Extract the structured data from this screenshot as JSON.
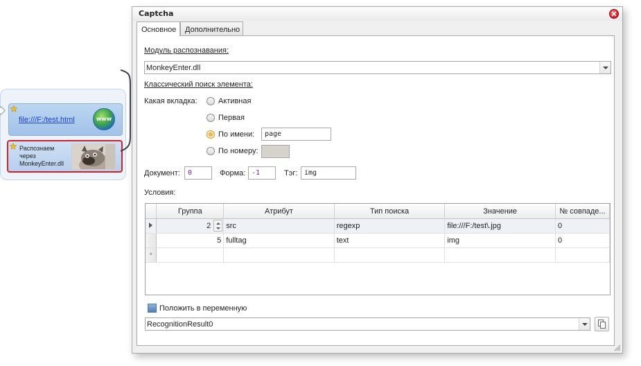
{
  "flow": {
    "nav_node_label": "file:///F:/test.html",
    "globe_text": "www",
    "captcha_node_label": "Распознаем через MonkeyEnter.dll"
  },
  "dialog": {
    "title": "Captcha",
    "tabs": [
      {
        "label": "Основное",
        "active": true
      },
      {
        "label": "Дополнительно",
        "active": false
      }
    ],
    "module_label": "Модуль распознавания:",
    "module_value": "MonkeyEnter.dll",
    "classic_label": "Классический поиск элемента:",
    "which_tab_label": "Какая вкладка:",
    "radios": [
      {
        "label": "Активная",
        "checked": false
      },
      {
        "label": "Первая",
        "checked": false
      },
      {
        "label": "По имени:",
        "checked": true
      },
      {
        "label": "По номеру:",
        "checked": false
      }
    ],
    "tab_name_value": "page",
    "tab_number_value": "",
    "document_label": "Документ:",
    "document_value": "0",
    "form_label": "Форма:",
    "form_value": "-1",
    "tag_label": "Тэг:",
    "tag_value": "img",
    "conditions_label": "Условия:",
    "grid": {
      "columns": [
        "Группа",
        "Атрибут",
        "Тип поиска",
        "Значение",
        "№ совпаде..."
      ],
      "rows": [
        {
          "group": "2",
          "attribute": "src",
          "search_type": "regexp",
          "value": "file:///F:/test\\.jpg",
          "match": "0",
          "selected": true
        },
        {
          "group": "5",
          "attribute": "fulltag",
          "search_type": "text",
          "value": "img",
          "match": "0",
          "selected": false
        }
      ],
      "new_row_marker": "*"
    },
    "save_var_label": "Положить в переменную",
    "variable_value": "RecognitionResult0"
  }
}
